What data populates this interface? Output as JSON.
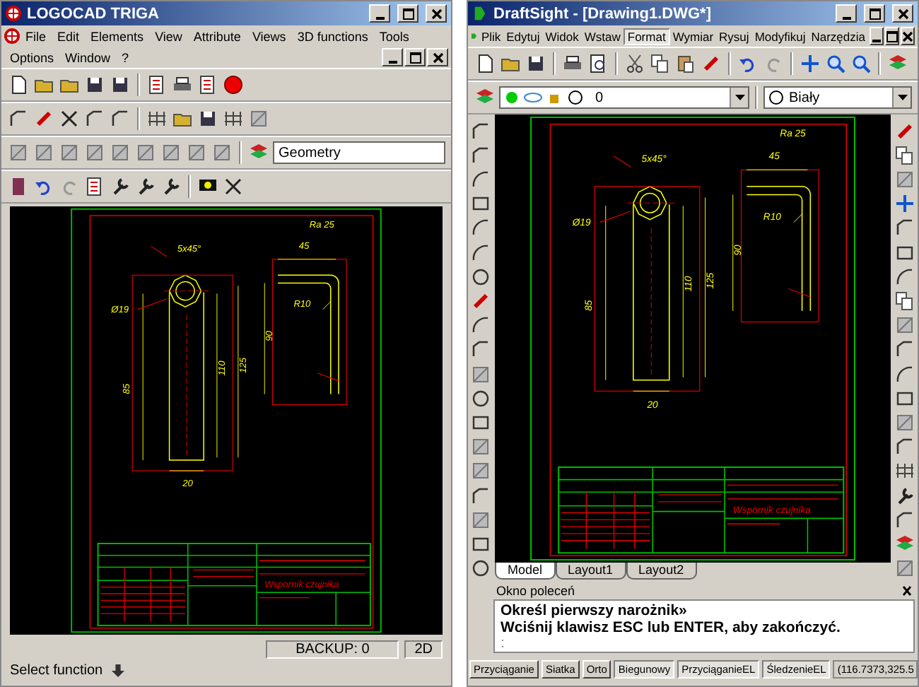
{
  "left_window": {
    "title": "LOGOCAD TRIGA",
    "menu": [
      "File",
      "Edit",
      "Elements",
      "View",
      "Attribute",
      "Views",
      "3D functions",
      "Tools"
    ],
    "menu_row2": [
      "Options",
      "Window",
      "?"
    ],
    "layer_field": "Geometry",
    "drawing": {
      "labels": [
        "Ra 25",
        "5x45°",
        "45",
        "R10",
        "Ø19",
        "110",
        "125",
        "90",
        "85",
        "20",
        "Wspornik czujnika"
      ]
    },
    "status_text": "Select function",
    "backup": "BACKUP: 0",
    "mode": "2D"
  },
  "right_window": {
    "title": "DraftSight - [Drawing1.DWG*]",
    "menu": [
      {
        "label": "Plik",
        "selected": false
      },
      {
        "label": "Edytuj",
        "selected": false
      },
      {
        "label": "Widok",
        "selected": false
      },
      {
        "label": "Wstaw",
        "selected": false
      },
      {
        "label": "Format",
        "selected": true
      },
      {
        "label": "Wymiar",
        "selected": false
      },
      {
        "label": "Rysuj",
        "selected": false
      },
      {
        "label": "Modyfikuj",
        "selected": false
      },
      {
        "label": "Narzędzia",
        "selected": false
      }
    ],
    "layer_value": "0",
    "color_value": "Biały",
    "drawing": {
      "labels": [
        "Ra 25",
        "5x45°",
        "45",
        "R10",
        "Ø19",
        "110",
        "125",
        "90",
        "85",
        "20",
        "Wspornik czujnika"
      ]
    },
    "tabs": [
      {
        "label": "Model",
        "selected": true
      },
      {
        "label": "Layout1",
        "selected": false
      },
      {
        "label": "Layout2",
        "selected": false
      }
    ],
    "command_title": "Okno poleceń",
    "command_lines": [
      "Określ pierwszy narożnik»",
      "Wciśnij klawisz ESC lub ENTER, aby zakończyć."
    ],
    "command_prompt": ":",
    "status_buttons": [
      {
        "label": "Przyciąganie",
        "on": false
      },
      {
        "label": "Siatka",
        "on": false
      },
      {
        "label": "Orto",
        "on": false
      },
      {
        "label": "Biegunowy",
        "on": true
      },
      {
        "label": "PrzyciąganieEL",
        "on": true
      },
      {
        "label": "ŚledzenieEL",
        "on": true
      }
    ],
    "coordinates": "(116.7373,325.5"
  }
}
